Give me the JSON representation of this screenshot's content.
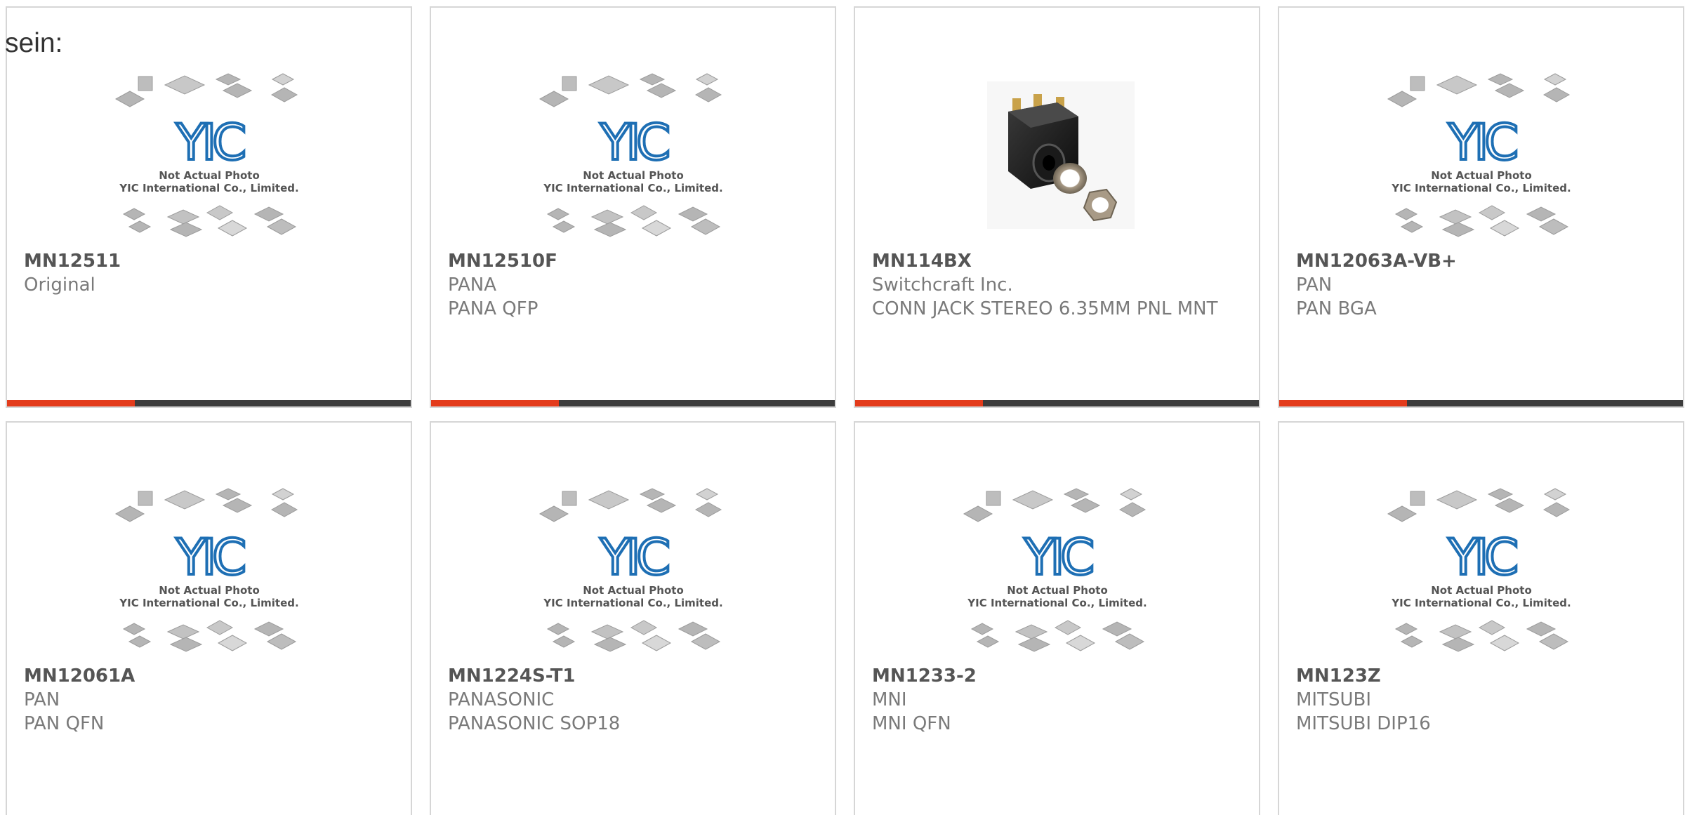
{
  "intro_text": "sein:",
  "placeholder_caption": {
    "line1": "Not Actual Photo",
    "line2": "YIC International Co., Limited."
  },
  "logo_text": "YIC",
  "colors": {
    "accent": "#e33b1b",
    "bar_dark": "#3c3c3c",
    "logo_blue": "#1e6fb4",
    "chip_gray": "#b5b5b5"
  },
  "products": [
    {
      "mpn": "MN12511",
      "manufacturer": "Original",
      "description": "",
      "image": "placeholder"
    },
    {
      "mpn": "MN12510F",
      "manufacturer": "PANA",
      "description": "PANA QFP",
      "image": "placeholder"
    },
    {
      "mpn": "MN114BX",
      "manufacturer": "Switchcraft Inc.",
      "description": "CONN JACK STEREO 6.35MM PNL MNT",
      "image": "audio-jack-photo"
    },
    {
      "mpn": "MN12063A-VB+",
      "manufacturer": "PAN",
      "description": "PAN BGA",
      "image": "placeholder"
    },
    {
      "mpn": "MN12061A",
      "manufacturer": "PAN",
      "description": "PAN QFN",
      "image": "placeholder"
    },
    {
      "mpn": "MN1224S-T1",
      "manufacturer": "PANASONIC",
      "description": "PANASONIC SOP18",
      "image": "placeholder"
    },
    {
      "mpn": "MN1233-2",
      "manufacturer": "MNI",
      "description": "MNI QFN",
      "image": "placeholder"
    },
    {
      "mpn": "MN123Z",
      "manufacturer": "MITSUBI",
      "description": "MITSUBI DIP16",
      "image": "placeholder"
    }
  ]
}
